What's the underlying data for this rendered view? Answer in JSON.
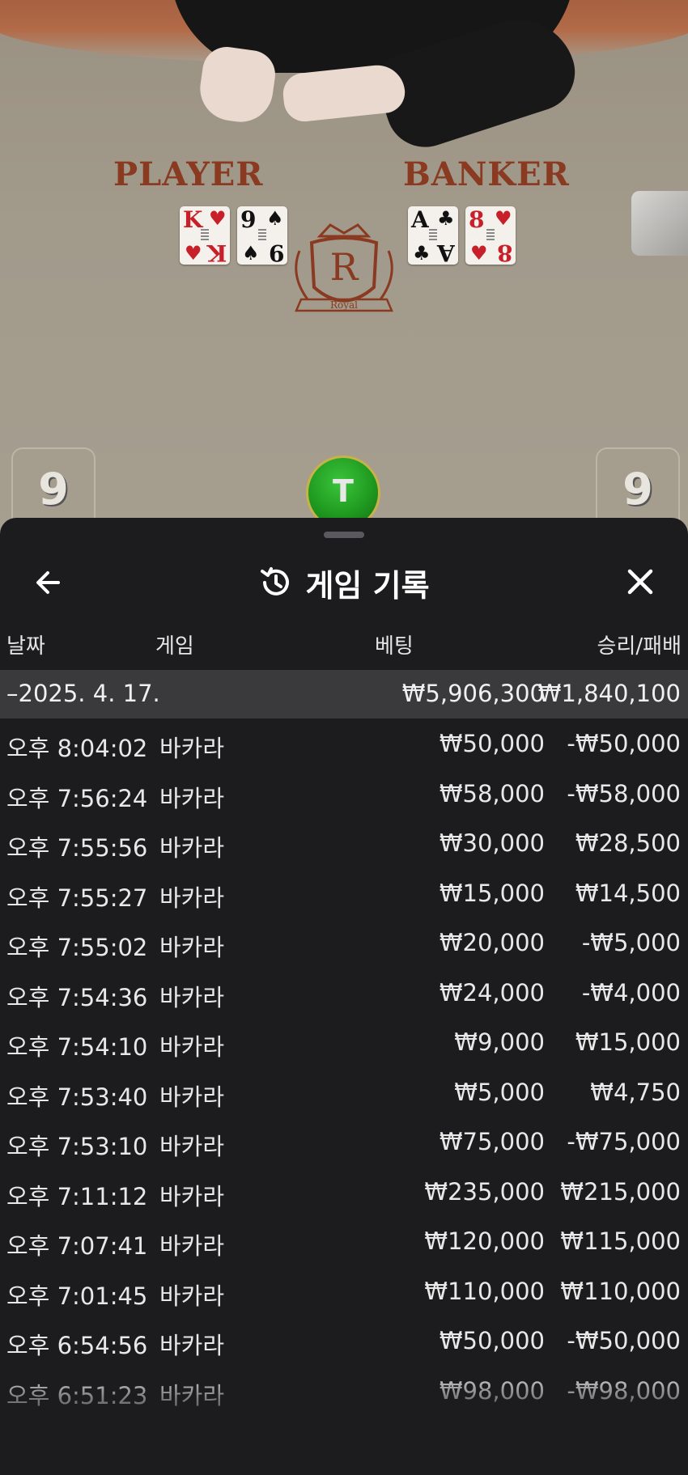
{
  "table": {
    "player_label": "PLAYER",
    "banker_label": "BANKER",
    "logo_letter": "R",
    "logo_text": "Royal",
    "player_cards": [
      {
        "rank": "K",
        "suit": "♥",
        "color": "#c8202a"
      },
      {
        "rank": "9",
        "suit": "♠",
        "color": "#111111"
      }
    ],
    "banker_cards": [
      {
        "rank": "A",
        "suit": "♣",
        "color": "#111111"
      },
      {
        "rank": "8",
        "suit": "♥",
        "color": "#c8202a"
      }
    ],
    "player_score": "9",
    "banker_score": "9",
    "result_chip": "T"
  },
  "sheet": {
    "title": "게임 기록",
    "columns": {
      "date": "날짜",
      "game": "게임",
      "bet": "베팅",
      "winloss": "승리/패배"
    },
    "summary": {
      "date": "–2025. 4. 17.",
      "bet": "₩5,906,300",
      "winloss": "₩1,840,100"
    },
    "rows": [
      {
        "time": "오후 8:04:02",
        "game": "바카라",
        "bet": "₩50,000",
        "winloss": "-₩50,000"
      },
      {
        "time": "오후 7:56:24",
        "game": "바카라",
        "bet": "₩58,000",
        "winloss": "-₩58,000"
      },
      {
        "time": "오후 7:55:56",
        "game": "바카라",
        "bet": "₩30,000",
        "winloss": "₩28,500"
      },
      {
        "time": "오후 7:55:27",
        "game": "바카라",
        "bet": "₩15,000",
        "winloss": "₩14,500"
      },
      {
        "time": "오후 7:55:02",
        "game": "바카라",
        "bet": "₩20,000",
        "winloss": "-₩5,000"
      },
      {
        "time": "오후 7:54:36",
        "game": "바카라",
        "bet": "₩24,000",
        "winloss": "-₩4,000"
      },
      {
        "time": "오후 7:54:10",
        "game": "바카라",
        "bet": "₩9,000",
        "winloss": "₩15,000"
      },
      {
        "time": "오후 7:53:40",
        "game": "바카라",
        "bet": "₩5,000",
        "winloss": "₩4,750"
      },
      {
        "time": "오후 7:53:10",
        "game": "바카라",
        "bet": "₩75,000",
        "winloss": "-₩75,000"
      },
      {
        "time": "오후 7:11:12",
        "game": "바카라",
        "bet": "₩235,000",
        "winloss": "₩215,000"
      },
      {
        "time": "오후 7:07:41",
        "game": "바카라",
        "bet": "₩120,000",
        "winloss": "₩115,000"
      },
      {
        "time": "오후 7:01:45",
        "game": "바카라",
        "bet": "₩110,000",
        "winloss": "₩110,000"
      },
      {
        "time": "오후 6:54:56",
        "game": "바카라",
        "bet": "₩50,000",
        "winloss": "-₩50,000"
      },
      {
        "time": "오후 6:51:23",
        "game": "바카라",
        "bet": "₩98,000",
        "winloss": "-₩98,000"
      }
    ],
    "icons": {
      "back": "arrow-left-icon",
      "history": "history-icon",
      "close": "close-icon"
    }
  }
}
